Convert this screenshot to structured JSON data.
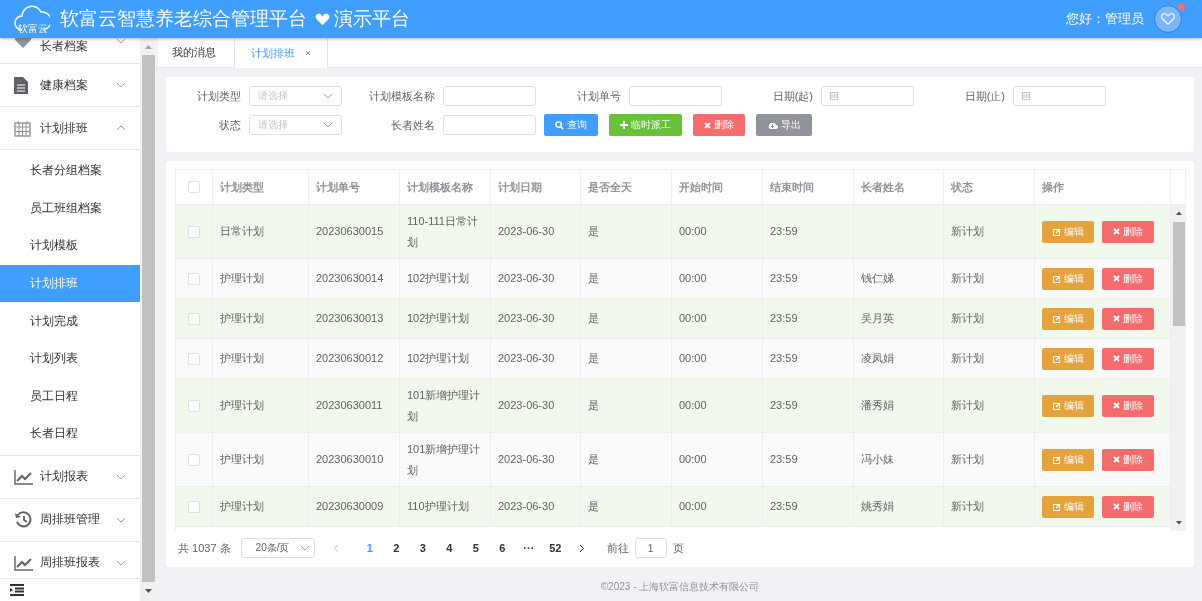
{
  "header": {
    "logo_text": "软富云",
    "title": "软富云智慧养老综合管理平台",
    "subtitle": "演示平台",
    "greeting": "您好：管理员",
    "notification": true
  },
  "sidebar": {
    "items": [
      {
        "label": "长者档案",
        "expanded": false
      },
      {
        "label": "健康档案",
        "expanded": false
      },
      {
        "label": "计划排班",
        "expanded": true,
        "children": [
          {
            "label": "长者分组档案",
            "selected": false
          },
          {
            "label": "员工班组档案",
            "selected": false
          },
          {
            "label": "计划模板",
            "selected": false
          },
          {
            "label": "计划排班",
            "selected": true
          },
          {
            "label": "计划完成",
            "selected": false
          },
          {
            "label": "计划列表",
            "selected": false
          },
          {
            "label": "员工日程",
            "selected": false
          },
          {
            "label": "长者日程",
            "selected": false
          }
        ]
      },
      {
        "label": "计划报表",
        "expanded": false
      },
      {
        "label": "周排班管理",
        "expanded": false
      },
      {
        "label": "周排班报表",
        "expanded": false
      }
    ]
  },
  "tabs": [
    {
      "label": "我的消息",
      "selected": false,
      "closable": false
    },
    {
      "label": "计划排班",
      "selected": true,
      "closable": true
    }
  ],
  "filters": [
    {
      "kind": "select",
      "label": "计划类型",
      "placeholder": "请选择"
    },
    {
      "kind": "text",
      "label": "计划模板名称"
    },
    {
      "kind": "text",
      "label": "计划单号"
    },
    {
      "kind": "date",
      "label": "日期(起)"
    },
    {
      "kind": "date",
      "label": "日期(止)"
    },
    {
      "kind": "select",
      "label": "状态",
      "placeholder": "请选择"
    },
    {
      "kind": "text",
      "label": "长者姓名"
    }
  ],
  "buttons": [
    {
      "label": "查询",
      "kind": "search"
    },
    {
      "label": "临时派工",
      "kind": "add"
    },
    {
      "label": "删除",
      "kind": "delete"
    },
    {
      "label": "导出",
      "kind": "export"
    }
  ],
  "table": {
    "select_all_checked": false,
    "columns": [
      "计划类型",
      "计划单号",
      "计划模板名称",
      "计划日期",
      "是否全天",
      "开始时间",
      "结束时间",
      "长者姓名",
      "状态",
      "操作"
    ],
    "rows": [
      {
        "checked": false,
        "cells": [
          "日常计划",
          "20230630015",
          "110-111日常计划",
          "2023-06-30",
          "是",
          "00:00",
          "23:59",
          null,
          "新计划"
        ],
        "actions": [
          {
            "label": "编辑",
            "kind": "edit"
          },
          {
            "label": "删除",
            "kind": "delete"
          }
        ]
      },
      {
        "checked": false,
        "cells": [
          "护理计划",
          "20230630014",
          "102护理计划",
          "2023-06-30",
          "是",
          "00:00",
          "23:59",
          "钱仁娣",
          "新计划"
        ],
        "actions": [
          {
            "label": "编辑",
            "kind": "edit"
          },
          {
            "label": "删除",
            "kind": "delete"
          }
        ]
      },
      {
        "checked": false,
        "cells": [
          "护理计划",
          "20230630013",
          "102护理计划",
          "2023-06-30",
          "是",
          "00:00",
          "23:59",
          "吴月英",
          "新计划"
        ],
        "actions": [
          {
            "label": "编辑",
            "kind": "edit"
          },
          {
            "label": "删除",
            "kind": "delete"
          }
        ]
      },
      {
        "checked": false,
        "cells": [
          "护理计划",
          "20230630012",
          "102护理计划",
          "2023-06-30",
          "是",
          "00:00",
          "23:59",
          "凌凤娟",
          "新计划"
        ],
        "actions": [
          {
            "label": "编辑",
            "kind": "edit"
          },
          {
            "label": "删除",
            "kind": "delete"
          }
        ]
      },
      {
        "checked": false,
        "cells": [
          "护理计划",
          "20230630011",
          "101新增护理计划",
          "2023-06-30",
          "是",
          "00:00",
          "23:59",
          "潘秀娟",
          "新计划"
        ],
        "actions": [
          {
            "label": "编辑",
            "kind": "edit"
          },
          {
            "label": "删除",
            "kind": "delete"
          }
        ]
      },
      {
        "checked": false,
        "cells": [
          "护理计划",
          "20230630010",
          "101新增护理计划",
          "2023-06-30",
          "是",
          "00:00",
          "23:59",
          "冯小妹",
          "新计划"
        ],
        "actions": [
          {
            "label": "编辑",
            "kind": "edit"
          },
          {
            "label": "删除",
            "kind": "delete"
          }
        ]
      },
      {
        "checked": false,
        "cells": [
          "护理计划",
          "20230630009",
          "110护理计划",
          "2023-06-30",
          "是",
          "00:00",
          "23:59",
          "姚秀娟",
          "新计划"
        ],
        "actions": [
          {
            "label": "编辑",
            "kind": "edit"
          },
          {
            "label": "删除",
            "kind": "delete"
          }
        ]
      }
    ]
  },
  "pagination": {
    "total": "共 1037 条",
    "page_size": "20条/页",
    "pages": [
      {
        "label": "1",
        "selected": true
      },
      {
        "label": "2",
        "selected": false
      },
      {
        "label": "3",
        "selected": false
      },
      {
        "label": "4",
        "selected": false
      },
      {
        "label": "5",
        "selected": false
      },
      {
        "label": "6",
        "selected": false
      },
      {
        "label": "···",
        "selected": false
      },
      {
        "label": "52",
        "selected": false
      }
    ],
    "goto_label": "前往",
    "goto_value": "1",
    "goto_suffix": "页"
  },
  "footer": "©2023 - 上海软富信息技术有限公司"
}
